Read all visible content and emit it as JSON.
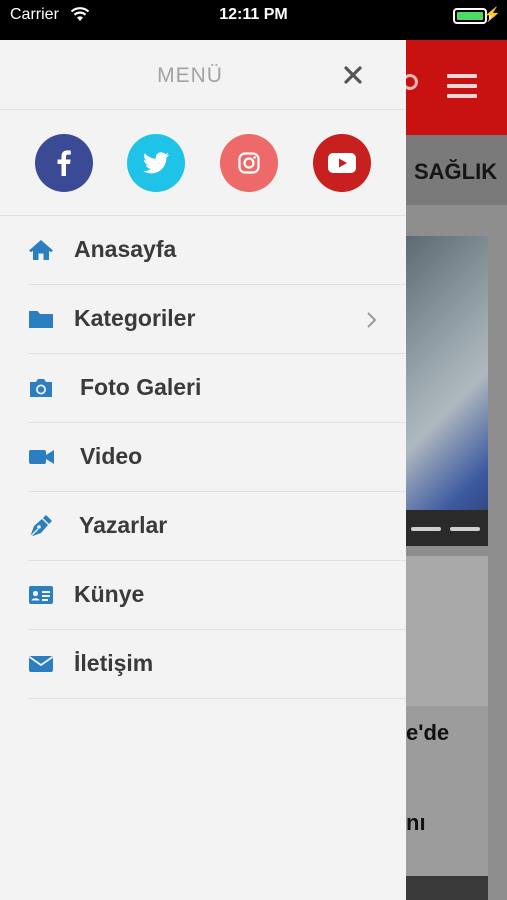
{
  "status_bar": {
    "carrier": "Carrier",
    "time": "12:11 PM",
    "battery_level": 1.0,
    "battery_color": "#4cd964"
  },
  "background": {
    "header_color": "#c81212",
    "category_label": "SAĞLIK",
    "card_text_1": "e'de",
    "card_text_2": "nı"
  },
  "drawer": {
    "title": "MENÜ",
    "close_icon": "close-icon",
    "social": [
      {
        "name": "facebook",
        "icon": "facebook-icon",
        "color": "#3b4a94"
      },
      {
        "name": "twitter",
        "icon": "twitter-icon",
        "color": "#1fc3e8"
      },
      {
        "name": "instagram",
        "icon": "instagram-icon",
        "color": "#ee6a6a"
      },
      {
        "name": "youtube",
        "icon": "youtube-icon",
        "color": "#c81f1f"
      }
    ],
    "items": [
      {
        "label": "Anasayfa",
        "icon": "home-icon"
      },
      {
        "label": "Kategoriler",
        "icon": "folder-icon",
        "has_submenu": true
      },
      {
        "label": "Foto Galeri",
        "icon": "camera-icon"
      },
      {
        "label": "Video",
        "icon": "video-camera-icon"
      },
      {
        "label": "Yazarlar",
        "icon": "pen-icon"
      },
      {
        "label": "Künye",
        "icon": "id-card-icon"
      },
      {
        "label": "İletişim",
        "icon": "envelope-icon"
      }
    ],
    "icon_color": "#2b7fc1"
  }
}
